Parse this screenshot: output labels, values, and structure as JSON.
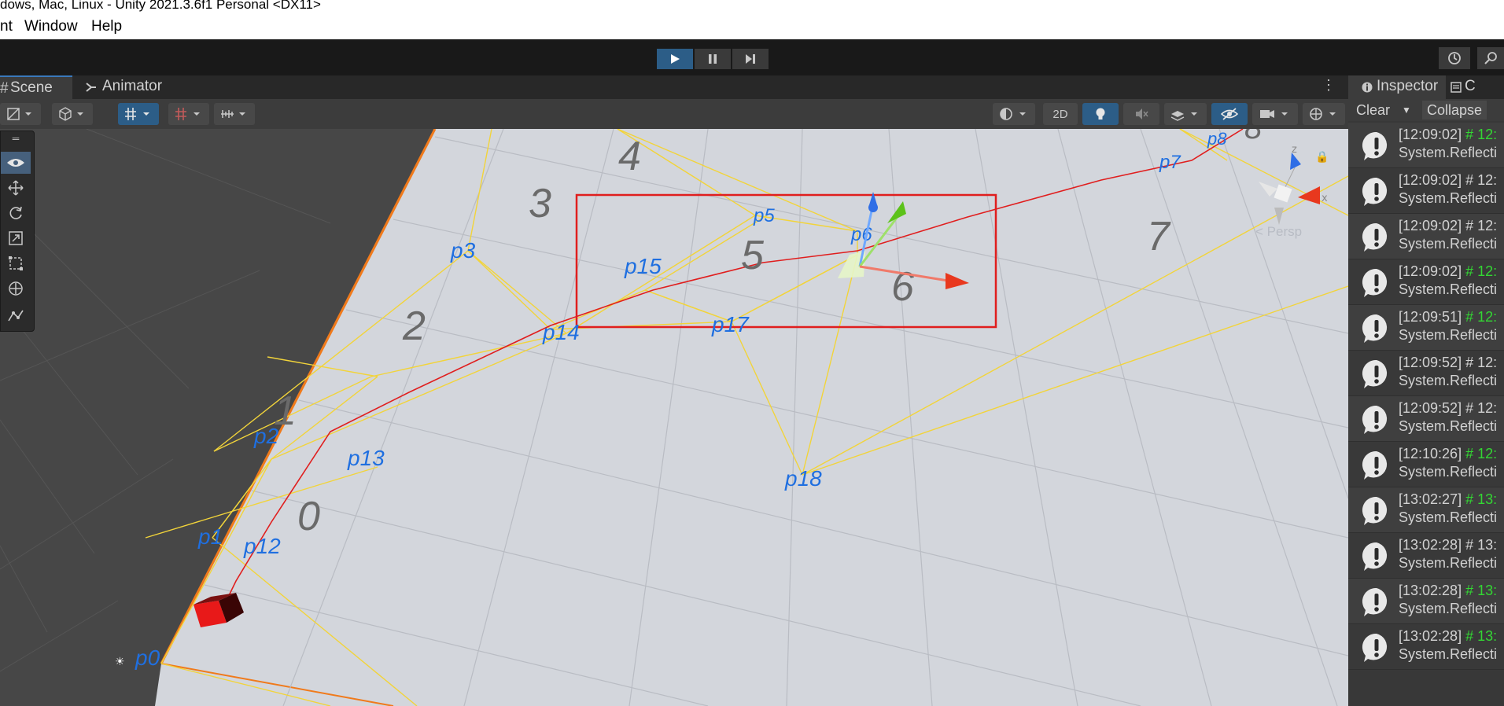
{
  "window": {
    "title": "dows, Mac, Linux - Unity 2021.3.6f1 Personal <DX11>"
  },
  "menu": {
    "items": [
      "nt",
      "Window",
      "Help"
    ]
  },
  "scene_tabs": [
    "Scene",
    "Animator"
  ],
  "scene_toolbar": {
    "toggle_2d": "2D"
  },
  "scene_labels": {
    "regions": [
      "0",
      "1",
      "2",
      "3",
      "4",
      "5",
      "6",
      "7",
      "8"
    ],
    "points": [
      "p0",
      "p1",
      "p2",
      "p3",
      "p5",
      "p6",
      "p7",
      "p8",
      "p12",
      "p13",
      "p14",
      "p15",
      "p17",
      "p18"
    ],
    "view_mode": "< Persp",
    "axis_z": "z",
    "axis_x": "x"
  },
  "right_panel": {
    "tabs": [
      "Inspector",
      "C"
    ],
    "clear": "Clear",
    "collapse": "Collapse"
  },
  "console_logs": [
    {
      "time": "[12:09:02]",
      "hash": "# 12:",
      "hash_color": "#33d633",
      "msg": "System.Reflecti"
    },
    {
      "time": "[12:09:02]",
      "hash": "# 12:",
      "hash_color": "#d2d2d2",
      "msg": "System.Reflecti"
    },
    {
      "time": "[12:09:02]",
      "hash": "# 12:",
      "hash_color": "#d2d2d2",
      "msg": "System.Reflecti"
    },
    {
      "time": "[12:09:02]",
      "hash": "# 12:",
      "hash_color": "#33d633",
      "msg": "System.Reflecti"
    },
    {
      "time": "[12:09:51]",
      "hash": "# 12:",
      "hash_color": "#33d633",
      "msg": "System.Reflecti"
    },
    {
      "time": "[12:09:52]",
      "hash": "# 12:",
      "hash_color": "#d2d2d2",
      "msg": "System.Reflecti"
    },
    {
      "time": "[12:09:52]",
      "hash": "# 12:",
      "hash_color": "#d2d2d2",
      "msg": "System.Reflecti"
    },
    {
      "time": "[12:10:26]",
      "hash": "# 12:",
      "hash_color": "#33d633",
      "msg": "System.Reflecti"
    },
    {
      "time": "[13:02:27]",
      "hash": "# 13:",
      "hash_color": "#33d633",
      "msg": "System.Reflecti"
    },
    {
      "time": "[13:02:28]",
      "hash": "# 13:",
      "hash_color": "#d2d2d2",
      "msg": "System.Reflecti"
    },
    {
      "time": "[13:02:28]",
      "hash": "# 13:",
      "hash_color": "#33d633",
      "msg": "System.Reflecti"
    },
    {
      "time": "[13:02:28]",
      "hash": "# 13:",
      "hash_color": "#33d633",
      "msg": "System.Reflecti"
    }
  ],
  "colors": {
    "accent": "#2c5d87",
    "path": "#e01e1e",
    "mesh_edge": "#f2d43a",
    "label_blue": "#1f6fe0",
    "plane_border": "#f07a1b"
  },
  "icons": {
    "play": "play-icon",
    "pause": "pause-icon",
    "step": "step-icon",
    "history": "history-icon",
    "search": "search-icon",
    "warning": "warning-icon"
  }
}
